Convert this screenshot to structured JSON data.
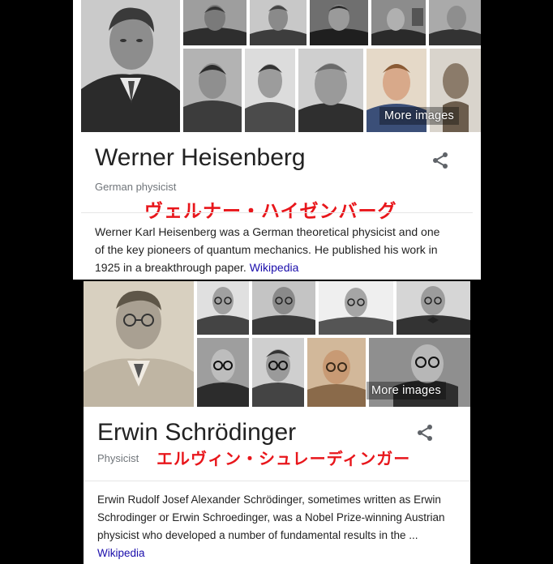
{
  "top_card": {
    "more_images": "More images",
    "name": "Werner Heisenberg",
    "subtitle": "German physicist",
    "japanese_name": "ヴェルナー・ハイゼンバーグ",
    "description": "Werner Karl Heisenberg was a German theoretical physicist and one of the key pioneers of quantum mechanics. He published his work in 1925 in a breakthrough paper.",
    "source_link": "Wikipedia",
    "share_icon": "share-icon"
  },
  "bottom_card": {
    "more_images": "More images",
    "name": "Erwin Schrödinger",
    "subtitle": "Physicist",
    "japanese_name": "エルヴィン・シュレーディンガー",
    "description": "Erwin Rudolf Josef Alexander Schrödinger, sometimes written as Erwin Schrodinger or Erwin Schroedinger, was a Nobel Prize-winning Austrian physicist who developed a number of fundamental results in the ...",
    "source_link": "Wikipedia",
    "share_icon": "share-icon"
  },
  "colors": {
    "background": "#000000",
    "card": "#ffffff",
    "title": "#222222",
    "subtitle": "#70757a",
    "japanese_annotation": "#e8161b",
    "link": "#1a0dab"
  }
}
